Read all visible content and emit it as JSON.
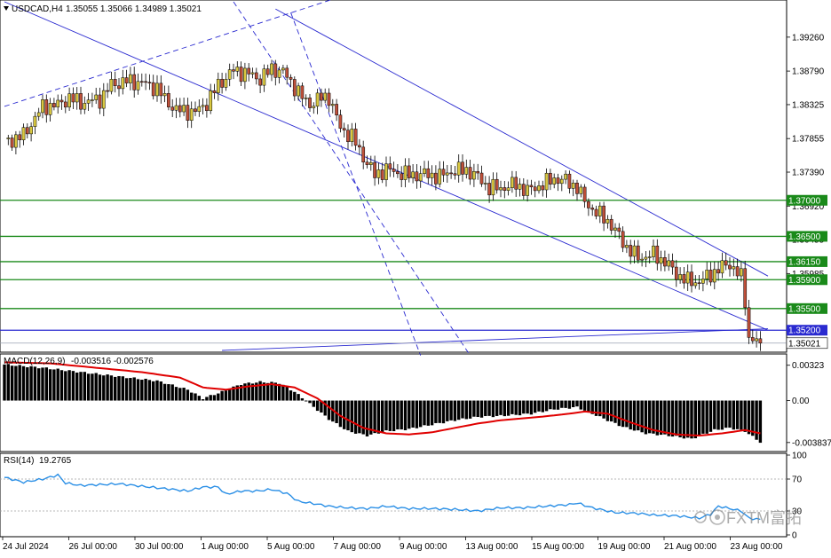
{
  "header": {
    "symbol": "USDCAD,H4",
    "ohlc": "1.35055 1.35066 1.34989 1.35021",
    "menu_icon": "triangle-down-icon"
  },
  "macd_header": {
    "name": "MACD(12,26,9)",
    "values": "-0.003516 -0.002576"
  },
  "rsi_header": {
    "name": "RSI(14)",
    "value": "19.2765"
  },
  "watermark": {
    "text": "FXTM富拓",
    "icon": "fxtm-logo-icon"
  },
  "colors": {
    "bull": "#d9c840",
    "bear": "#c0503a",
    "support": "#1a8a1a",
    "trend": "#2a2ad0",
    "signal": "#e00000",
    "rsi": "#2a8fe6",
    "hist": "#000000"
  },
  "chart_data": [
    {
      "type": "candlestick",
      "title": "USDCAD,H4",
      "ylim": [
        1.3492,
        1.3975
      ],
      "price_ticks": [
        "1.39260",
        "1.38790",
        "1.38325",
        "1.37855",
        "1.37390",
        "1.36920",
        "1.36455",
        "1.35985"
      ],
      "levels": [
        {
          "value": 1.37,
          "label": "1.37000",
          "color": "support"
        },
        {
          "value": 1.365,
          "label": "1.36500",
          "color": "support"
        },
        {
          "value": 1.3615,
          "label": "1.36150",
          "color": "support"
        },
        {
          "value": 1.359,
          "label": "1.35900",
          "color": "support"
        },
        {
          "value": 1.355,
          "label": "1.35500",
          "color": "support"
        },
        {
          "value": 1.352,
          "label": "1.35200",
          "color": "trend"
        },
        {
          "value": 1.35021,
          "label": "1.35021",
          "color": "current"
        }
      ],
      "x_labels": [
        "24 Jul 2024",
        "26 Jul 00:00",
        "30 Jul 00:00",
        "1 Aug 00:00",
        "5 Aug 00:00",
        "7 Aug 00:00",
        "9 Aug 00:00",
        "13 Aug 00:00",
        "15 Aug 00:00",
        "19 Aug 00:00",
        "21 Aug 00:00",
        "23 Aug 00:00"
      ],
      "close_anchors": [
        [
          0,
          1.378
        ],
        [
          5,
          1.379
        ],
        [
          10,
          1.383
        ],
        [
          14,
          1.3832
        ],
        [
          17,
          1.3842
        ],
        [
          20,
          1.3835
        ],
        [
          25,
          1.384
        ],
        [
          28,
          1.386
        ],
        [
          32,
          1.3865
        ],
        [
          36,
          1.3863
        ],
        [
          40,
          1.3855
        ],
        [
          42,
          1.384
        ],
        [
          45,
          1.3825
        ],
        [
          50,
          1.3822
        ],
        [
          53,
          1.3835
        ],
        [
          56,
          1.386
        ],
        [
          60,
          1.388
        ],
        [
          64,
          1.3875
        ],
        [
          67,
          1.3868
        ],
        [
          70,
          1.3882
        ],
        [
          73,
          1.3878
        ],
        [
          76,
          1.3857
        ],
        [
          78,
          1.3842
        ],
        [
          80,
          1.3833
        ],
        [
          83,
          1.3842
        ],
        [
          85,
          1.3843
        ],
        [
          88,
          1.38
        ],
        [
          91,
          1.3788
        ],
        [
          94,
          1.376
        ],
        [
          97,
          1.3735
        ],
        [
          100,
          1.3743
        ],
        [
          103,
          1.3738
        ],
        [
          106,
          1.3735
        ],
        [
          110,
          1.3736
        ],
        [
          114,
          1.3733
        ],
        [
          117,
          1.374
        ],
        [
          121,
          1.3742
        ],
        [
          124,
          1.3732
        ],
        [
          127,
          1.3717
        ],
        [
          130,
          1.3717
        ],
        [
          134,
          1.3722
        ],
        [
          137,
          1.3713
        ],
        [
          141,
          1.3722
        ],
        [
          144,
          1.373
        ],
        [
          147,
          1.3727
        ],
        [
          150,
          1.3718
        ],
        [
          152,
          1.3698
        ],
        [
          155,
          1.3683
        ],
        [
          158,
          1.3672
        ],
        [
          161,
          1.365
        ],
        [
          163,
          1.3635
        ],
        [
          166,
          1.362
        ],
        [
          170,
          1.3625
        ],
        [
          173,
          1.3615
        ],
        [
          176,
          1.3598
        ],
        [
          179,
          1.3588
        ],
        [
          182,
          1.3587
        ],
        [
          185,
          1.3597
        ],
        [
          187,
          1.3605
        ],
        [
          190,
          1.3612
        ],
        [
          193,
          1.3593
        ],
        [
          194,
          1.356
        ],
        [
          195,
          1.351
        ],
        [
          197,
          1.3505
        ],
        [
          198,
          1.35021
        ]
      ],
      "trendlines": [
        {
          "style": "solid",
          "from": [
            0,
            1.3975
          ],
          "to": [
            200,
            1.352
          ]
        },
        {
          "style": "dashed",
          "from": [
            0,
            1.383
          ],
          "to": [
            88,
            1.3982
          ]
        },
        {
          "style": "solid",
          "from": [
            71,
            1.3965
          ],
          "to": [
            200,
            1.3595
          ]
        },
        {
          "style": "dashed",
          "from": [
            60,
            1.3975
          ],
          "to": [
            122,
            1.3485
          ]
        },
        {
          "style": "dashed",
          "from": [
            75,
            1.396
          ],
          "to": [
            109,
            1.3485
          ]
        },
        {
          "style": "solid",
          "from": [
            57,
            1.3492
          ],
          "to": [
            200,
            1.3522
          ]
        }
      ]
    },
    {
      "type": "bar",
      "title": "MACD(12,26,9)",
      "ylim": [
        -0.0045,
        0.0041
      ],
      "ticks": [
        "0.00323",
        "0.00",
        "-0.003837"
      ],
      "hist_anchors": [
        [
          0,
          0.0033
        ],
        [
          10,
          0.003
        ],
        [
          20,
          0.0026
        ],
        [
          30,
          0.0022
        ],
        [
          40,
          0.0018
        ],
        [
          48,
          0.001
        ],
        [
          52,
          0.0002
        ],
        [
          57,
          0.0008
        ],
        [
          62,
          0.0015
        ],
        [
          67,
          0.0017
        ],
        [
          72,
          0.0016
        ],
        [
          76,
          0.0008
        ],
        [
          80,
          -0.0003
        ],
        [
          85,
          -0.0017
        ],
        [
          90,
          -0.0028
        ],
        [
          95,
          -0.0032
        ],
        [
          100,
          -0.0028
        ],
        [
          106,
          -0.0026
        ],
        [
          112,
          -0.0022
        ],
        [
          118,
          -0.0018
        ],
        [
          124,
          -0.0015
        ],
        [
          130,
          -0.0014
        ],
        [
          138,
          -0.0012
        ],
        [
          144,
          -0.0008
        ],
        [
          150,
          -0.0006
        ],
        [
          156,
          -0.0015
        ],
        [
          162,
          -0.0024
        ],
        [
          168,
          -0.003
        ],
        [
          174,
          -0.0032
        ],
        [
          180,
          -0.0035
        ],
        [
          186,
          -0.0027
        ],
        [
          190,
          -0.0025
        ],
        [
          194,
          -0.0028
        ],
        [
          198,
          -0.0038
        ]
      ],
      "signal_anchors": [
        [
          0,
          0.0035
        ],
        [
          12,
          0.0034
        ],
        [
          24,
          0.003
        ],
        [
          36,
          0.0026
        ],
        [
          46,
          0.0021
        ],
        [
          52,
          0.0012
        ],
        [
          58,
          0.001
        ],
        [
          64,
          0.0013
        ],
        [
          70,
          0.0015
        ],
        [
          76,
          0.0012
        ],
        [
          82,
          0.0002
        ],
        [
          88,
          -0.0014
        ],
        [
          94,
          -0.0025
        ],
        [
          100,
          -0.003
        ],
        [
          106,
          -0.0031
        ],
        [
          112,
          -0.0029
        ],
        [
          118,
          -0.0025
        ],
        [
          124,
          -0.0021
        ],
        [
          130,
          -0.0018
        ],
        [
          140,
          -0.0015
        ],
        [
          148,
          -0.0012
        ],
        [
          152,
          -0.001
        ],
        [
          158,
          -0.0012
        ],
        [
          164,
          -0.002
        ],
        [
          170,
          -0.0027
        ],
        [
          176,
          -0.0031
        ],
        [
          182,
          -0.0032
        ],
        [
          188,
          -0.003
        ],
        [
          194,
          -0.0027
        ],
        [
          198,
          -0.003
        ]
      ]
    },
    {
      "type": "line",
      "title": "RSI(14)",
      "ylim": [
        0,
        100
      ],
      "ticks": [
        "100",
        "70",
        "30",
        "0"
      ],
      "rsi_anchors": [
        [
          0,
          72
        ],
        [
          5,
          66
        ],
        [
          10,
          70
        ],
        [
          14,
          75
        ],
        [
          16,
          65
        ],
        [
          20,
          62
        ],
        [
          30,
          64
        ],
        [
          40,
          59
        ],
        [
          48,
          55
        ],
        [
          52,
          60
        ],
        [
          56,
          60
        ],
        [
          58,
          51
        ],
        [
          62,
          55
        ],
        [
          66,
          55
        ],
        [
          70,
          57
        ],
        [
          74,
          52
        ],
        [
          77,
          42
        ],
        [
          80,
          40
        ],
        [
          85,
          36
        ],
        [
          90,
          34
        ],
        [
          95,
          33
        ],
        [
          100,
          36
        ],
        [
          106,
          33
        ],
        [
          112,
          33
        ],
        [
          118,
          32
        ],
        [
          124,
          30
        ],
        [
          130,
          34
        ],
        [
          136,
          34
        ],
        [
          142,
          36
        ],
        [
          148,
          38
        ],
        [
          150,
          40
        ],
        [
          154,
          34
        ],
        [
          160,
          28
        ],
        [
          166,
          27
        ],
        [
          170,
          25
        ],
        [
          176,
          24
        ],
        [
          182,
          21
        ],
        [
          185,
          26
        ],
        [
          187,
          36
        ],
        [
          190,
          33
        ],
        [
          193,
          30
        ],
        [
          195,
          21
        ],
        [
          198,
          19.2765
        ]
      ]
    }
  ]
}
